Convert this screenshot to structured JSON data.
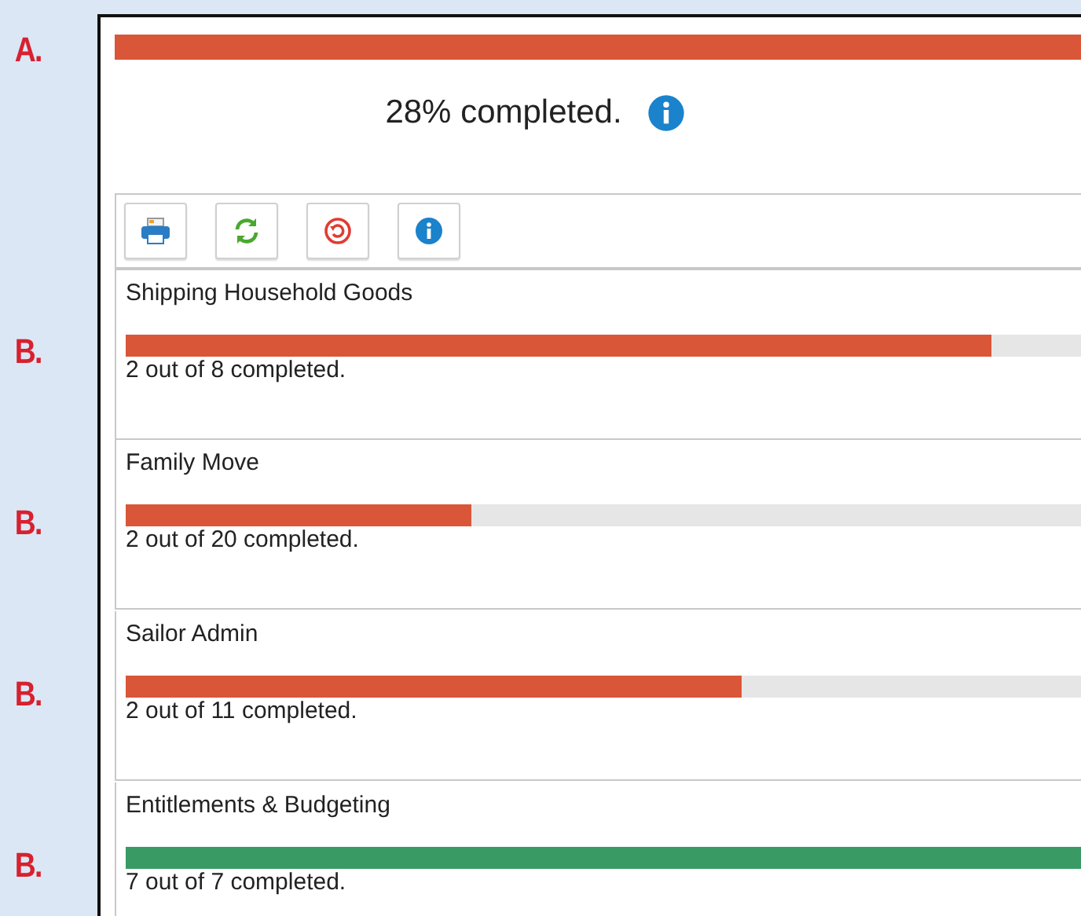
{
  "overall": {
    "marker": "A.",
    "level": 1,
    "color": "#d95638",
    "summary": "28% completed."
  },
  "toolbar": {
    "buttons": [
      {
        "kind": "print"
      },
      {
        "kind": "refresh"
      },
      {
        "kind": "reset"
      },
      {
        "kind": "info"
      }
    ]
  },
  "sections": [
    {
      "marker": "B.",
      "title": "Shipping Household Goods",
      "level": 0.9,
      "color": "#d95638",
      "progress": "2 out of 8 completed."
    },
    {
      "marker": "B.",
      "title": "Family Move",
      "level": 0.36,
      "color": "#d95638",
      "progress": "2 out of 20 completed."
    },
    {
      "marker": "B.",
      "title": "Sailor Admin",
      "level": 0.64,
      "color": "#d95638",
      "progress": "2 out of 11 completed."
    },
    {
      "marker": "B.",
      "title": "Entitlements & Budgeting",
      "level": 1,
      "color": "#3a9a64",
      "progress": "7 out of 7 completed."
    }
  ]
}
